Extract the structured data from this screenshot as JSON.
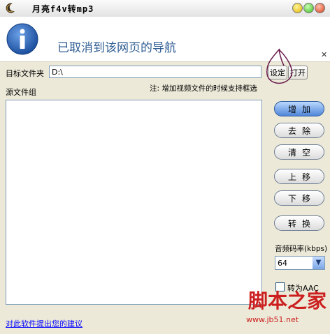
{
  "window": {
    "title": "月亮f4v转mp3"
  },
  "nav_error": {
    "message": "已取消到该网页的导航"
  },
  "form": {
    "target_folder_label": "目标文件夹",
    "target_folder_value": "D:\\",
    "set_button": "设定",
    "open_button": "打开",
    "note": "注: 增加视频文件的时候支持框选",
    "source_group_label": "源文件组"
  },
  "side_buttons": {
    "add": "增加",
    "remove": "去除",
    "clear": "清空",
    "move_up": "上移",
    "move_down": "下移",
    "convert": "转换"
  },
  "bitrate": {
    "label": "音频码率(kbps)",
    "value": "64"
  },
  "aac": {
    "label": "转为AAC",
    "checked": false
  },
  "footer": {
    "suggest_link": "对此软件提出您的建议"
  },
  "watermark": {
    "logo_text": "脚本之家",
    "url": "www.jb51.net"
  },
  "colors": {
    "panel_bg": "#ece9d8",
    "nav_text": "#2f5d93",
    "primary_button": "#4f86d8",
    "watermark": "#cc1f1f"
  },
  "icons": [
    "moon-app-icon",
    "info-icon",
    "close-icon",
    "minimize-icon",
    "maximize-icon",
    "chevron-down-icon"
  ]
}
